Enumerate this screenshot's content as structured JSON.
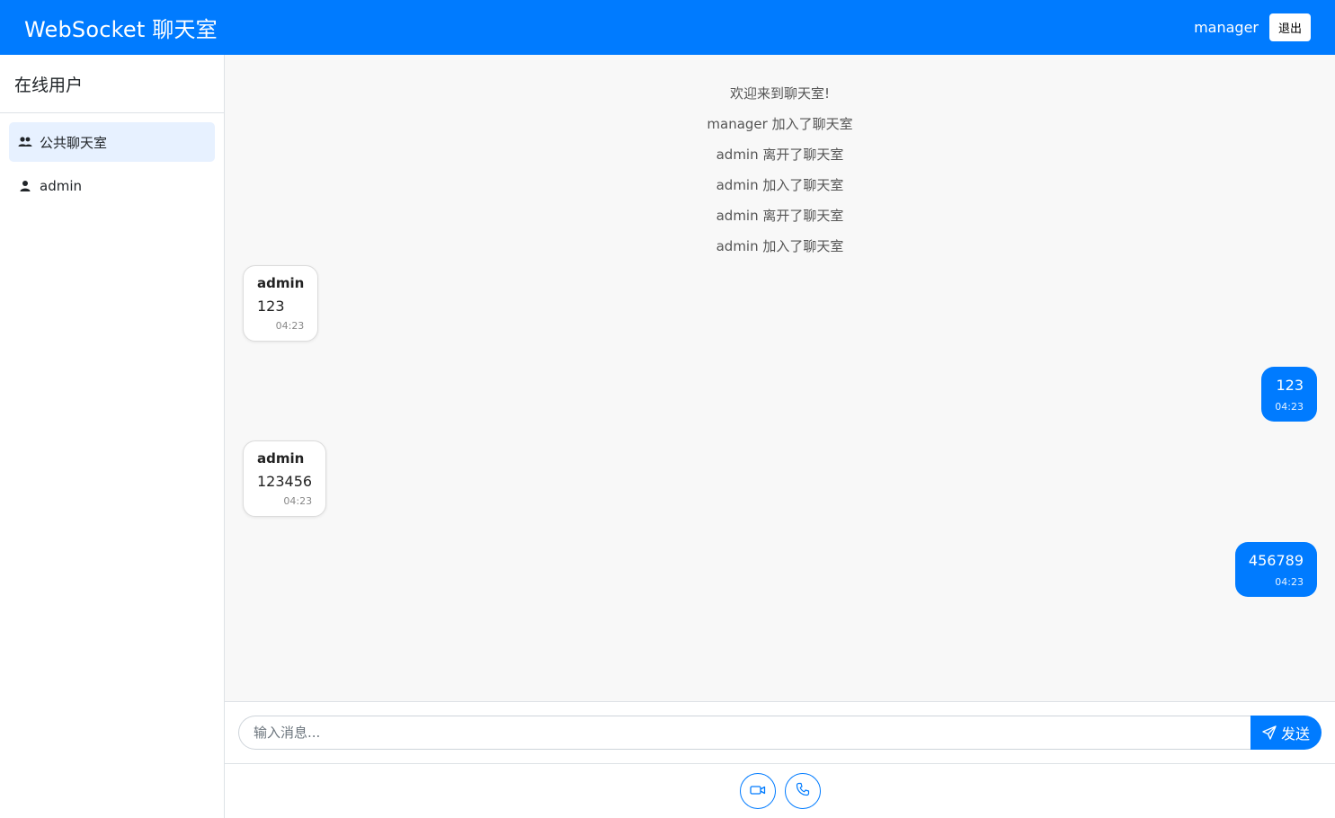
{
  "navbar": {
    "brand": "WebSocket 聊天室",
    "username": "manager",
    "logout_label": "退出"
  },
  "sidebar": {
    "title": "在线用户",
    "items": [
      {
        "label": "公共聊天室",
        "icon": "users-icon",
        "active": true
      },
      {
        "label": "admin",
        "icon": "user-icon",
        "active": false
      }
    ]
  },
  "chat": {
    "system_messages": [
      "欢迎来到聊天室!",
      "manager 加入了聊天室",
      "admin 离开了聊天室",
      "admin 加入了聊天室",
      "admin 离开了聊天室",
      "admin 加入了聊天室"
    ],
    "messages": [
      {
        "sender": "admin",
        "text": "123",
        "time": "04:23",
        "own": false
      },
      {
        "text": "123",
        "time": "04:23",
        "own": true
      },
      {
        "sender": "admin",
        "text": "123456",
        "time": "04:23",
        "own": false
      },
      {
        "text": "456789",
        "time": "04:23",
        "own": true
      }
    ]
  },
  "composer": {
    "placeholder": "输入消息...",
    "send_label": "发送"
  },
  "call_buttons": [
    {
      "icon": "video-camera-icon"
    },
    {
      "icon": "phone-icon"
    }
  ],
  "colors": {
    "primary": "#007bff",
    "active_item_bg": "#e7f1ff",
    "chat_bg": "#f8f8f8"
  }
}
